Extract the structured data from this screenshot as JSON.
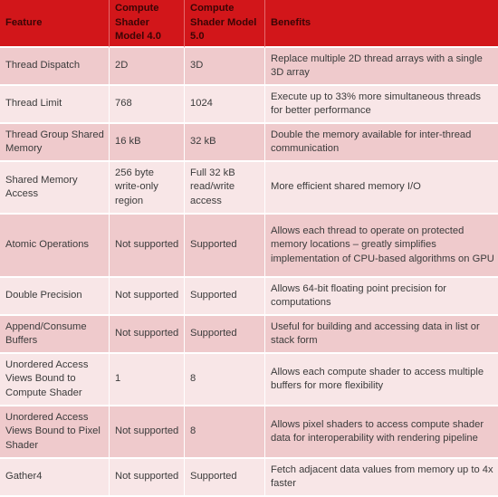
{
  "table": {
    "headers": [
      "Feature",
      "Compute Shader Model 4.0",
      "Compute Shader Model 5.0",
      "Benefits"
    ],
    "rows": [
      {
        "feature": "Thread Dispatch",
        "sm4": "2D",
        "sm5": "3D",
        "benefit": "Replace multiple 2D thread arrays with a single 3D array"
      },
      {
        "feature": "Thread Limit",
        "sm4": "768",
        "sm5": "1024",
        "benefit": "Execute up to 33% more simultaneous threads for better performance"
      },
      {
        "feature": "Thread Group Shared Memory",
        "sm4": "16 kB",
        "sm5": "32 kB",
        "benefit": "Double the memory available for inter-thread communication"
      },
      {
        "feature": "Shared Memory Access",
        "sm4": "256 byte write-only region",
        "sm5": "Full 32 kB read/write access",
        "benefit": "More efficient shared memory I/O"
      },
      {
        "feature": "Atomic Operations",
        "sm4": "Not supported",
        "sm5": "Supported",
        "benefit": "Allows each thread to operate on protected memory locations – greatly simplifies implementation of CPU-based algorithms on GPU"
      },
      {
        "feature": "Double Precision",
        "sm4": "Not supported",
        "sm5": "Supported",
        "benefit": "Allows 64-bit floating point precision for computations"
      },
      {
        "feature": "Append/Consume Buffers",
        "sm4": "Not supported",
        "sm5": "Supported",
        "benefit": "Useful for building and accessing data in list or stack form"
      },
      {
        "feature": "Unordered Access Views Bound to Compute Shader",
        "sm4": "1",
        "sm5": "8",
        "benefit": "Allows each compute shader to access multiple buffers for more flexibility"
      },
      {
        "feature": "Unordered Access Views Bound to Pixel Shader",
        "sm4": "Not supported",
        "sm5": "8",
        "benefit": "Allows pixel shaders to access compute shader data for interoperability with rendering pipeline"
      },
      {
        "feature": "Gather4",
        "sm4": "Not supported",
        "sm5": "Supported",
        "benefit": "Fetch adjacent data values from memory up to 4x faster"
      }
    ]
  },
  "colors": {
    "header_bg": "#D2161A",
    "row_dark": "#EFCACC",
    "row_light": "#F8E6E7"
  }
}
